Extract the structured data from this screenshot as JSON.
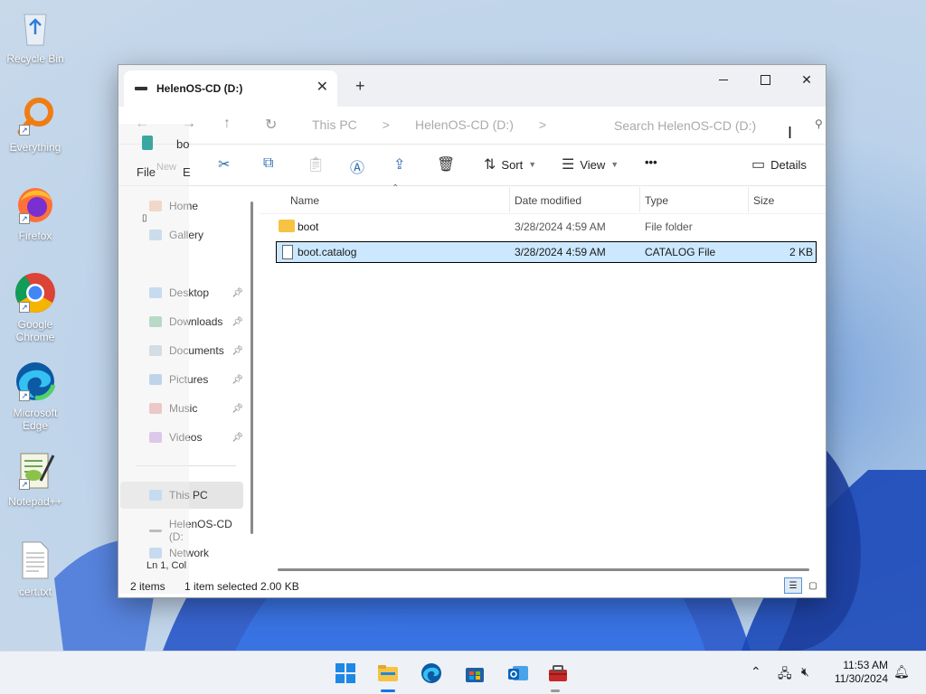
{
  "desktop": {
    "icons": [
      {
        "label": "Recycle Bin",
        "icon": "recycle-bin-icon"
      },
      {
        "label": "Everything",
        "icon": "everything-search-icon"
      },
      {
        "label": "Firefox",
        "icon": "firefox-icon"
      },
      {
        "label": "Google Chrome",
        "icon": "chrome-icon"
      },
      {
        "label": "Microsoft Edge",
        "icon": "edge-icon"
      },
      {
        "label": "Notepad++",
        "icon": "notepadpp-icon"
      },
      {
        "label": "cert.txt",
        "icon": "text-file-icon"
      }
    ]
  },
  "window": {
    "tab_title": "HelenOS-CD (D:)",
    "new_tab": "+",
    "close_tab": "✕",
    "close_window": "✕",
    "address": {
      "crumbs": [
        "This PC",
        ">",
        "HelenOS-CD (D:)",
        ">"
      ],
      "search_placeholder": "Search HelenOS-CD (D:)"
    },
    "ghost": {
      "file_menu": "File",
      "edit_menu": "E",
      "filename_fragment": "bo",
      "new_label": "New",
      "status_fragment": "Ln 1, Col"
    },
    "commands": {
      "sort": "Sort",
      "view": "View",
      "more": "•••",
      "details": "Details"
    },
    "nav": {
      "home": "Home",
      "gallery": "Gallery",
      "desktop": "Desktop",
      "downloads": "Downloads",
      "documents": "Documents",
      "pictures": "Pictures",
      "music": "Music",
      "videos": "Videos",
      "this_pc": "This PC",
      "drive": "HelenOS-CD (D:",
      "network": "Network"
    },
    "columns": {
      "name": "Name",
      "date": "Date modified",
      "type": "Type",
      "size": "Size"
    },
    "files": [
      {
        "name": "boot",
        "date": "3/28/2024 4:59 AM",
        "type": "File folder",
        "size": "",
        "icon": "folder-icon"
      },
      {
        "name": "boot.catalog",
        "date": "3/28/2024 4:59 AM",
        "type": "CATALOG File",
        "size": "2 KB",
        "icon": "file-icon",
        "selected": true
      }
    ],
    "status": {
      "items": "2 items",
      "selected": "1 item selected",
      "size": "2.00 KB"
    }
  },
  "taskbar": {
    "time": "11:53 AM",
    "date": "11/30/2024"
  },
  "colors": {
    "selection": "#cce8ff",
    "accent": "#1a73e8",
    "folder": "#f6c343"
  }
}
